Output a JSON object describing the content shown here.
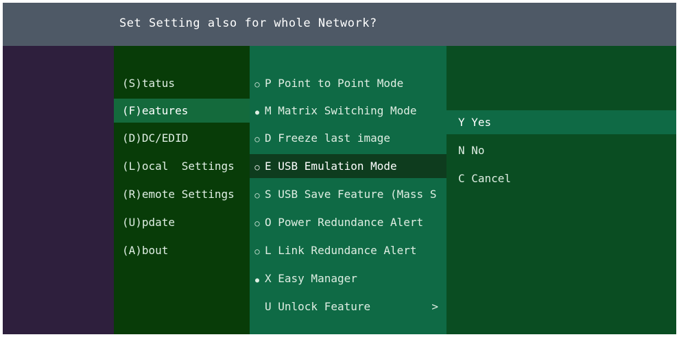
{
  "dialog": {
    "title": "Set Setting also for whole Network?"
  },
  "main_menu": {
    "items": [
      {
        "label": "(S)tatus",
        "active": false
      },
      {
        "label": "(F)eatures",
        "active": true
      },
      {
        "label": "(D)DC/EDID",
        "active": false
      },
      {
        "label": "(L)ocal  Settings",
        "active": false
      },
      {
        "label": "(R)emote Settings",
        "active": false
      },
      {
        "label": "(U)pdate",
        "active": false
      },
      {
        "label": "(A)bout",
        "active": false
      }
    ]
  },
  "features_menu": {
    "items": [
      {
        "label": "P Point to Point Mode",
        "bullet": "empty"
      },
      {
        "label": "M Matrix Switching Mode",
        "bullet": "filled"
      },
      {
        "label": "D Freeze last image",
        "bullet": "empty"
      },
      {
        "label": "E USB Emulation Mode",
        "bullet": "empty",
        "active": true
      },
      {
        "label": "S USB Save Feature (Mass S",
        "bullet": "empty"
      },
      {
        "label": "O Power Redundance Alert",
        "bullet": "empty"
      },
      {
        "label": "L Link Redundance Alert",
        "bullet": "empty"
      },
      {
        "label": "X Easy Manager",
        "bullet": "filled"
      },
      {
        "label": "U Unlock Feature",
        "bullet": "none",
        "chevron": ">"
      }
    ]
  },
  "confirm_menu": {
    "items": [
      {
        "label": "Y Yes",
        "active": true
      },
      {
        "label": "N No",
        "active": false
      },
      {
        "label": "C Cancel",
        "active": false
      }
    ]
  },
  "colors": {
    "title_bar": "#4e5966",
    "background": "#2e1f3d",
    "menu1_bg": "#083c08",
    "menu1_active": "#146a3c",
    "menu2_bg": "#0f6a45",
    "menu2_active": "#0e3c1e",
    "menu3_bg": "#0a4d22",
    "menu3_active": "#0f6a45"
  }
}
